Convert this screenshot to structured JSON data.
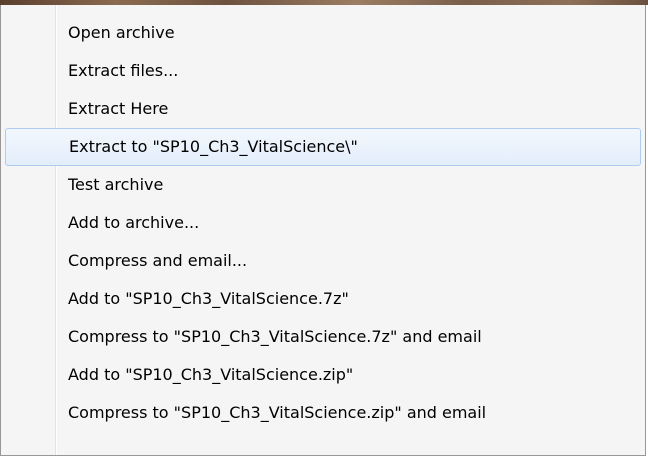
{
  "context_menu": {
    "items": [
      {
        "label": "Open archive"
      },
      {
        "label": "Extract files..."
      },
      {
        "label": "Extract Here"
      },
      {
        "label": "Extract to \"SP10_Ch3_VitalScience\\\""
      },
      {
        "label": "Test archive"
      },
      {
        "label": "Add to archive..."
      },
      {
        "label": "Compress and email..."
      },
      {
        "label": "Add to \"SP10_Ch3_VitalScience.7z\""
      },
      {
        "label": "Compress to \"SP10_Ch3_VitalScience.7z\" and email"
      },
      {
        "label": "Add to \"SP10_Ch3_VitalScience.zip\""
      },
      {
        "label": "Compress to \"SP10_Ch3_VitalScience.zip\" and email"
      }
    ],
    "highlight_color": "#e3eefb",
    "highlight_border": "#aeccf1"
  }
}
